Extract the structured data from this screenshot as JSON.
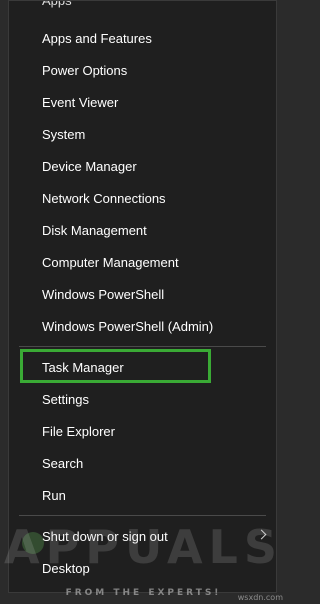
{
  "menu": {
    "clipped_top_label": "Apps",
    "items": [
      {
        "label": "Apps and Features"
      },
      {
        "label": "Power Options"
      },
      {
        "label": "Event Viewer"
      },
      {
        "label": "System"
      },
      {
        "label": "Device Manager"
      },
      {
        "label": "Network Connections"
      },
      {
        "label": "Disk Management"
      },
      {
        "label": "Computer Management"
      },
      {
        "label": "Windows PowerShell"
      },
      {
        "label": "Windows PowerShell (Admin)"
      },
      {
        "label": "Task Manager"
      },
      {
        "label": "Settings"
      },
      {
        "label": "File Explorer"
      },
      {
        "label": "Search"
      },
      {
        "label": "Run"
      },
      {
        "label": "Shut down or sign out"
      },
      {
        "label": "Desktop"
      }
    ]
  },
  "highlight": {
    "target": "Task Manager",
    "color": "#3aaa35"
  },
  "watermark": {
    "logo_text": "APPUALS",
    "tagline": "FROM THE EXPERTS!",
    "site": "wsxdn.com"
  }
}
